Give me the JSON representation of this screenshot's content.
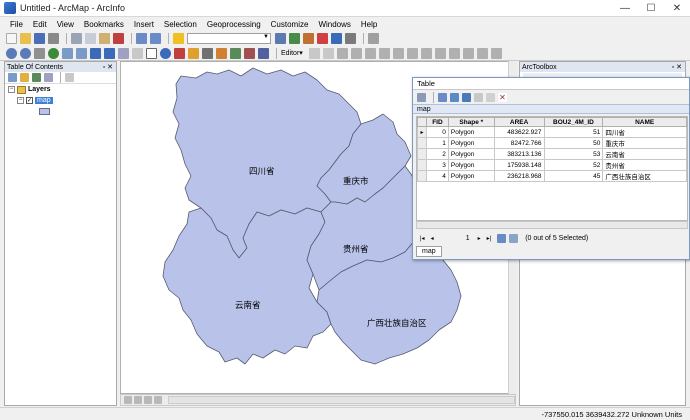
{
  "window": {
    "title": "Untitled - ArcMap - ArcInfo",
    "controls": [
      "—",
      "☐",
      "✕"
    ]
  },
  "menu": [
    "File",
    "Edit",
    "View",
    "Bookmarks",
    "Insert",
    "Selection",
    "Geoprocessing",
    "Customize",
    "Windows",
    "Help"
  ],
  "toolbar": {
    "editor_label": "Editor▾",
    "scale_value": ""
  },
  "toc": {
    "title": "Table Of Contents",
    "pin": "▫ ✕",
    "layers_label": "Layers",
    "layer_name": "map",
    "expander_open": "−"
  },
  "map": {
    "labels": {
      "sichuan": "四川省",
      "chongqing": "重庆市",
      "guizhou": "贵州省",
      "yunnan": "云南省",
      "guangxi": "广西壮族自治区"
    },
    "fill_color": "#b9c3ea",
    "stroke_color": "#555a70"
  },
  "toolbox": {
    "title": "ArcToolbox",
    "pin": "▫ ✕"
  },
  "table_window": {
    "title": "Table",
    "table_name": "map",
    "columns": [
      "FID",
      "Shape *",
      "AREA",
      "BOU2_4M_ID",
      "NAME"
    ],
    "rows": [
      {
        "marker": "▸",
        "fid": "0",
        "shape": "Polygon",
        "area": "483622.927",
        "bou": "51",
        "name": "四川省"
      },
      {
        "marker": "",
        "fid": "1",
        "shape": "Polygon",
        "area": "82472.766",
        "bou": "50",
        "name": "重庆市"
      },
      {
        "marker": "",
        "fid": "2",
        "shape": "Polygon",
        "area": "383213.136",
        "bou": "53",
        "name": "云南省"
      },
      {
        "marker": "",
        "fid": "3",
        "shape": "Polygon",
        "area": "175938.148",
        "bou": "52",
        "name": "贵州省"
      },
      {
        "marker": "",
        "fid": "4",
        "shape": "Polygon",
        "area": "236218.968",
        "bou": "45",
        "name": "广西壮族自治区"
      }
    ],
    "nav": {
      "first": "|◂",
      "prev": "◂",
      "record": "1",
      "next": "▸",
      "last": "▸|",
      "selection_text": "(0 out of 5 Selected)"
    },
    "tab_label": "map"
  },
  "status": {
    "coords": "-737550.015  3639432.272 Unknown Units"
  }
}
